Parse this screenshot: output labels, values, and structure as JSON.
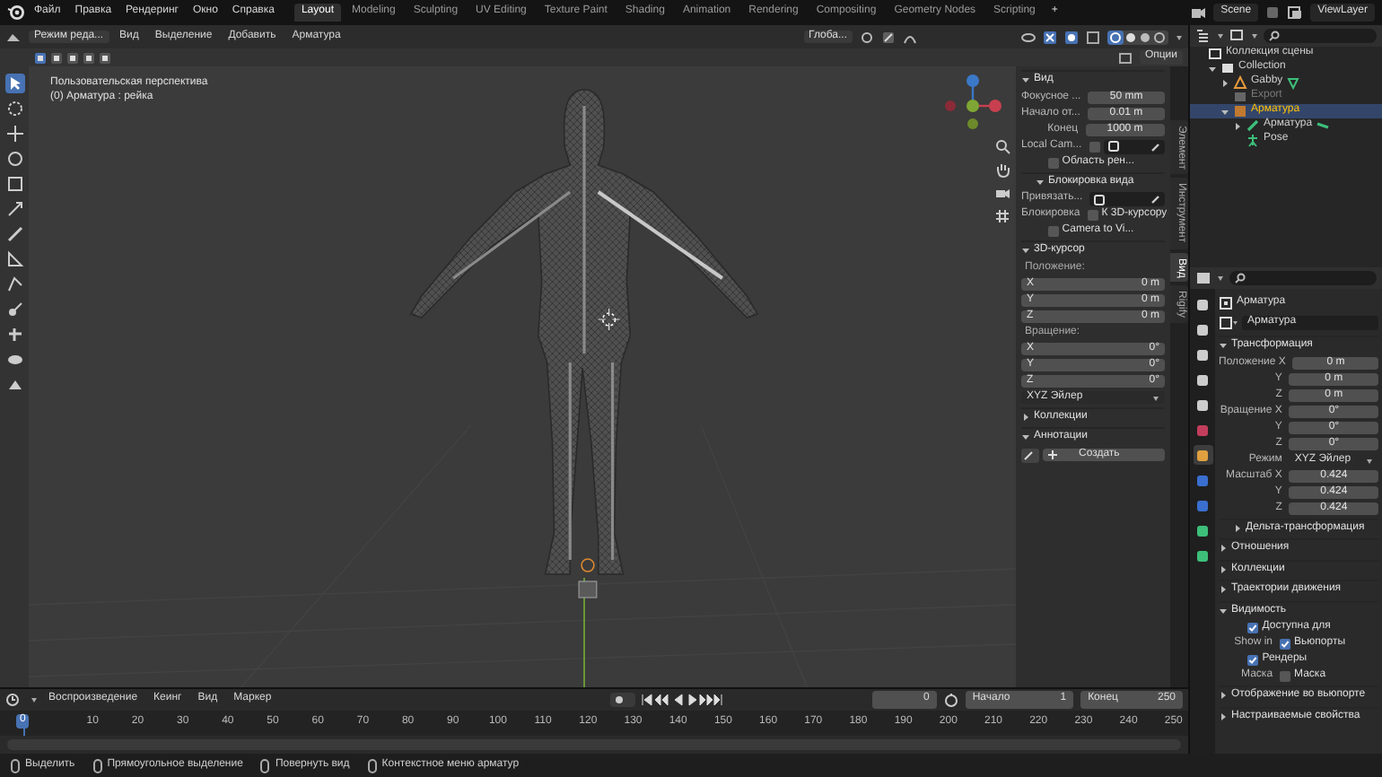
{
  "menu": [
    "Файл",
    "Правка",
    "Рендеринг",
    "Окно",
    "Справка"
  ],
  "workspaces": [
    {
      "label": "Layout",
      "selected": true
    },
    {
      "label": "Modeling",
      "selected": false
    },
    {
      "label": "Sculpting",
      "selected": false
    },
    {
      "label": "UV Editing",
      "selected": false
    },
    {
      "label": "Texture Paint",
      "selected": false
    },
    {
      "label": "Shading",
      "selected": false
    },
    {
      "label": "Animation",
      "selected": false
    },
    {
      "label": "Rendering",
      "selected": false
    },
    {
      "label": "Compositing",
      "selected": false
    },
    {
      "label": "Geometry Nodes",
      "selected": false
    },
    {
      "label": "Scripting",
      "selected": false
    }
  ],
  "add_workspace": "+",
  "scene": "Scene",
  "view_layer": "ViewLayer",
  "viewport": {
    "mode": "Режим реда...",
    "menus": [
      "Вид",
      "Выделение",
      "Добавить",
      "Арматура"
    ],
    "orientation": "Глоба...",
    "options": "Опции",
    "overlay_lines": [
      "Пользовательская перспектива",
      "(0) Арматура : рейка"
    ],
    "tools": [
      {
        "selected": true
      },
      {
        "selected": false
      },
      {
        "selected": false
      },
      {
        "selected": false
      },
      {
        "selected": false
      },
      {
        "selected": false
      },
      {
        "selected": false
      },
      {
        "selected": false
      },
      {
        "selected": false
      },
      {
        "selected": false
      },
      {
        "selected": false
      },
      {
        "selected": false
      },
      {
        "selected": false
      }
    ]
  },
  "n_panel": {
    "tabs": [
      {
        "label": "Элемент",
        "selected": false
      },
      {
        "label": "Инструмент",
        "selected": false
      },
      {
        "label": "Вид",
        "selected": true
      },
      {
        "label": "Rigify",
        "selected": false
      }
    ],
    "rows": [
      {
        "kind": "header",
        "label": "Вид",
        "expanded": true
      },
      {
        "kind": "field",
        "label": "Фокусное ...",
        "value": "50 mm"
      },
      {
        "kind": "field",
        "label": "Начало от...",
        "value": "0.01 m"
      },
      {
        "kind": "field",
        "label": "Конец",
        "value": "1000 m"
      },
      {
        "kind": "check_field",
        "label": "Local Cam...",
        "checked": false
      },
      {
        "kind": "check",
        "text": "Область рен...",
        "checked": false
      },
      {
        "kind": "subheader",
        "label": "Блокировка вида",
        "expanded": true
      },
      {
        "kind": "objfield",
        "label": "Привязать..."
      },
      {
        "kind": "check",
        "label": "Блокировка",
        "text": "К 3D-курсору",
        "checked": false
      },
      {
        "kind": "check",
        "text": "Camera to Vi...",
        "checked": false
      },
      {
        "kind": "header",
        "label": "3D-курсор",
        "expanded": true
      },
      {
        "kind": "label",
        "label": "Положение:"
      },
      {
        "kind": "inner_field",
        "label": "X",
        "value": "0 m"
      },
      {
        "kind": "inner_field",
        "label": "Y",
        "value": "0 m"
      },
      {
        "kind": "inner_field",
        "label": "Z",
        "value": "0 m"
      },
      {
        "kind": "label",
        "label": "Вращение:"
      },
      {
        "kind": "inner_field",
        "label": "X",
        "value": "0°"
      },
      {
        "kind": "inner_field",
        "label": "Y",
        "value": "0°"
      },
      {
        "kind": "inner_field",
        "label": "Z",
        "value": "0°"
      },
      {
        "kind": "dropdown",
        "value": "XYZ Эйлер"
      },
      {
        "kind": "header",
        "label": "Коллекции",
        "expanded": false
      },
      {
        "kind": "header",
        "label": "Аннотации",
        "expanded": true
      },
      {
        "kind": "button",
        "label": "Создать"
      }
    ]
  },
  "outliner": {
    "items": [
      {
        "kind": "scene_collection",
        "label": "Коллекция сцены",
        "selected": false,
        "children": [
          {
            "kind": "collection",
            "label": "Collection",
            "selected": false,
            "expanded": true,
            "children": [
              {
                "kind": "mesh_object",
                "label": "Gabby",
                "selected": false,
                "expanded": false
              },
              {
                "kind": "excluded_collection",
                "label": "Export",
                "selected": false
              },
              {
                "kind": "armature_object",
                "label": "Арматура",
                "selected": true,
                "expanded": true,
                "children": [
                  {
                    "kind": "armature_data",
                    "label": "Арматура",
                    "selected": false,
                    "expanded": false
                  },
                  {
                    "kind": "pose",
                    "label": "Pose",
                    "selected": false
                  }
                ]
              }
            ]
          }
        ]
      }
    ]
  },
  "properties": {
    "tabs": [
      {
        "selected": false
      },
      {
        "selected": false
      },
      {
        "selected": false
      },
      {
        "selected": false
      },
      {
        "selected": false
      },
      {
        "selected": false
      },
      {
        "selected": true
      },
      {
        "selected": false
      },
      {
        "selected": false
      },
      {
        "selected": false
      },
      {
        "selected": false
      }
    ],
    "rows": [
      {
        "kind": "title",
        "label": "Арматура"
      },
      {
        "kind": "datablock",
        "label": "Арматура"
      },
      {
        "kind": "header",
        "label": "Трансформация",
        "expanded": true
      },
      {
        "kind": "field",
        "label": "Положение X",
        "value": "0 m"
      },
      {
        "kind": "field",
        "label": "Y",
        "value": "0 m"
      },
      {
        "kind": "field",
        "label": "Z",
        "value": "0 m"
      },
      {
        "kind": "field",
        "label": "Вращение X",
        "value": "0°"
      },
      {
        "kind": "field",
        "label": "Y",
        "value": "0°"
      },
      {
        "kind": "field",
        "label": "Z",
        "value": "0°"
      },
      {
        "kind": "dropdown",
        "label": "Режим",
        "value": "XYZ Эйлер"
      },
      {
        "kind": "field",
        "label": "Масштаб X",
        "value": "0.424"
      },
      {
        "kind": "field",
        "label": "Y",
        "value": "0.424"
      },
      {
        "kind": "field",
        "label": "Z",
        "value": "0.424"
      },
      {
        "kind": "subheader",
        "label": "Дельта-трансформация",
        "expanded": false
      },
      {
        "kind": "header",
        "label": "Отношения",
        "expanded": false
      },
      {
        "kind": "header",
        "label": "Коллекции",
        "expanded": false
      },
      {
        "kind": "header",
        "label": "Траектории движения",
        "expanded": false
      },
      {
        "kind": "header",
        "label": "Видимость",
        "expanded": true
      },
      {
        "kind": "check",
        "text": "Доступна для",
        "checked": true
      },
      {
        "kind": "check",
        "label": "Show in",
        "text": "Вьюпорты",
        "checked": true
      },
      {
        "kind": "check",
        "text": "Рендеры",
        "checked": true
      },
      {
        "kind": "check",
        "label": "Маска",
        "text": "Маска",
        "checked": false
      },
      {
        "kind": "header",
        "label": "Отображение во вьюпорте",
        "expanded": false
      },
      {
        "kind": "header",
        "label": "Настраиваемые свойства",
        "expanded": false
      }
    ]
  },
  "timeline": {
    "menus": [
      "Воспроизведение",
      "Кеинг",
      "Вид",
      "Маркер"
    ],
    "frame": "0",
    "start_label": "Начало",
    "start": "1",
    "end_label": "Конец",
    "end": "250",
    "current_marker": "0",
    "ruler": [
      "10",
      "20",
      "30",
      "40",
      "50",
      "60",
      "70",
      "80",
      "90",
      "100",
      "110",
      "120",
      "130",
      "140",
      "150",
      "160",
      "170",
      "180",
      "190",
      "200",
      "210",
      "220",
      "230",
      "240",
      "250"
    ]
  },
  "status_bar": [
    "Выделить",
    "Прямоугольное выделение",
    "Повернуть вид",
    "Контекстное меню арматур"
  ]
}
